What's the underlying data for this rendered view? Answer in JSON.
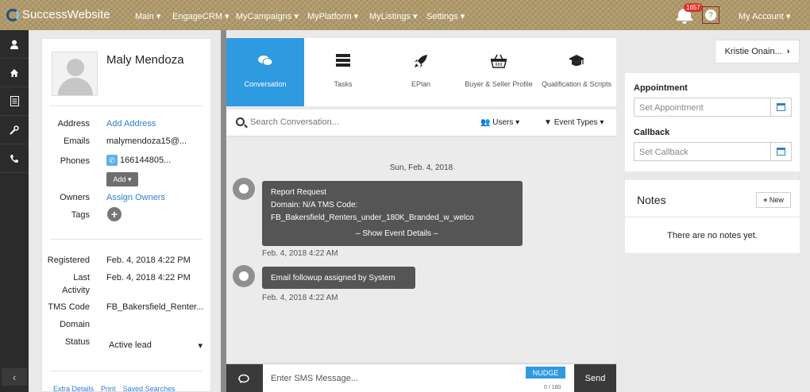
{
  "header": {
    "brand": "SuccessWebsite",
    "nav": [
      "Main",
      "EngageCRM",
      "MyCampaigns",
      "MyPlatform",
      "MyListings",
      "Settings"
    ],
    "notification_count": "1657",
    "help_glyph": "?",
    "account": "My Account"
  },
  "rail": {
    "items": [
      "user-icon",
      "home-icon",
      "document-icon",
      "wrench-icon",
      "phone-icon"
    ],
    "collapse_glyph": "‹"
  },
  "contact": {
    "name": "Maly Mendoza",
    "address_label": "Address",
    "address_value": "Add Address",
    "emails_label": "Emails",
    "emails_value": "malymendoza15@...",
    "phones_label": "Phones",
    "phones_value": "166144805...",
    "add_button": "Add",
    "owners_label": "Owners",
    "owners_value": "Assign Owners",
    "tags_label": "Tags",
    "registered_label": "Registered",
    "registered_value": "Feb. 4, 2018 4:22 PM",
    "last_label": "Last",
    "activity_label": "Activity",
    "last_activity_value": "Feb. 4, 2018 4:22 PM",
    "tms_label": "TMS Code",
    "tms_value": "FB_Bakersfield_Renter...",
    "domain_label": "Domain",
    "status_label": "Status",
    "status_value": "Active lead",
    "footer_links": [
      "Extra Details",
      "Print",
      "Saved Searches"
    ]
  },
  "tabs": [
    {
      "label": "Conversation",
      "icon": "chat-icon",
      "active": true
    },
    {
      "label": "Tasks",
      "icon": "tasks-icon",
      "active": false
    },
    {
      "label": "EPlan",
      "icon": "rocket-icon",
      "active": false
    },
    {
      "label": "Buyer & Seller Profile",
      "icon": "basket-icon",
      "active": false
    },
    {
      "label": "Qualification & Scripts",
      "icon": "graduation-cap-icon",
      "active": false
    }
  ],
  "conversation": {
    "search_placeholder": "Search Conversation...",
    "users_filter": "Users",
    "event_types_filter": "Event Types",
    "date_header": "Sun, Feb. 4, 2018",
    "events": [
      {
        "title": "Report Request",
        "line2": "Domain: N/A   TMS Code:",
        "line3": "FB_Bakersfield_Renters_under_180K_Branded_w_welco",
        "action": "Show Event Details",
        "time": "Feb. 4, 2018 4:22 AM"
      },
      {
        "title": "Email followup assigned by System",
        "time": "Feb. 4, 2018 4:22 AM"
      }
    ],
    "sms_placeholder": "Enter SMS Message...",
    "nudge": "NUDGE",
    "counter": "0 / 160",
    "send": "Send"
  },
  "right": {
    "assigned_agent": "Kristie Onain...",
    "appointment_label": "Appointment",
    "appointment_placeholder": "Set Appointment",
    "callback_label": "Callback",
    "callback_placeholder": "Set Callback",
    "notes_title": "Notes",
    "new_button": "New",
    "notes_empty": "There are no notes yet."
  },
  "colors": {
    "accent": "#2e9ae0",
    "header": "#b09a6a",
    "rail": "#2b2b2b",
    "bubble": "#555555",
    "badge": "#e0302a"
  }
}
